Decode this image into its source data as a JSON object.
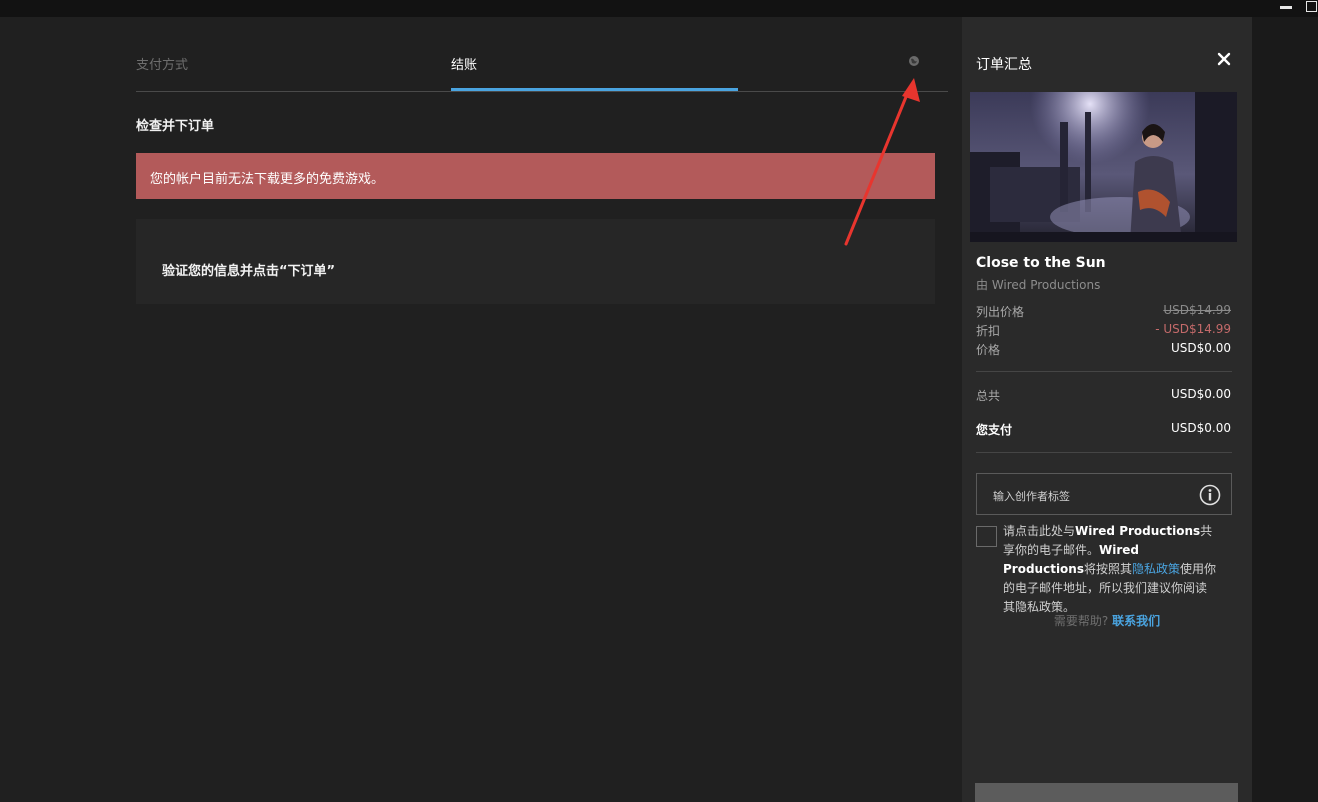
{
  "tabs": {
    "payment": "支付方式",
    "checkout": "结账"
  },
  "section_title": "检查并下订单",
  "error_message": "您的帐户目前无法下载更多的免费游戏。",
  "verify_text": "验证您的信息并点击“下订单”",
  "summary": {
    "title": "订单汇总",
    "game_title": "Close to the Sun",
    "publisher": "由 Wired Productions",
    "list_price_label": "列出价格",
    "list_price_value": "USD$14.99",
    "discount_label": "折扣",
    "discount_value": "- USD$14.99",
    "price_label": "价格",
    "price_value": "USD$0.00",
    "total_label": "总共",
    "total_value": "USD$0.00",
    "pay_label": "您支付",
    "pay_value": "USD$0.00",
    "creator_tag_placeholder": "输入创作者标签",
    "share": {
      "part1": "请点击此处与",
      "company1": "Wired Productions",
      "part2": "共享你的电子邮件。",
      "company2": "Wired Productions",
      "part3": "将按照其",
      "privacy_link": "隐私政策",
      "part4": "使用你的电子邮件地址，所以我们建议你阅读其隐私政策。"
    },
    "help_text": "需要帮助?",
    "contact_link": "联系我们"
  },
  "colors": {
    "background": "#202020",
    "panel": "#2a2a2a",
    "error": "#b35a5a",
    "accent": "#4aa4e0",
    "discount": "#c46a6a",
    "annotation_arrow": "#e8352e"
  },
  "icons": [
    "minimize-icon",
    "maximize-icon",
    "globe-icon",
    "close-icon",
    "info-icon"
  ]
}
